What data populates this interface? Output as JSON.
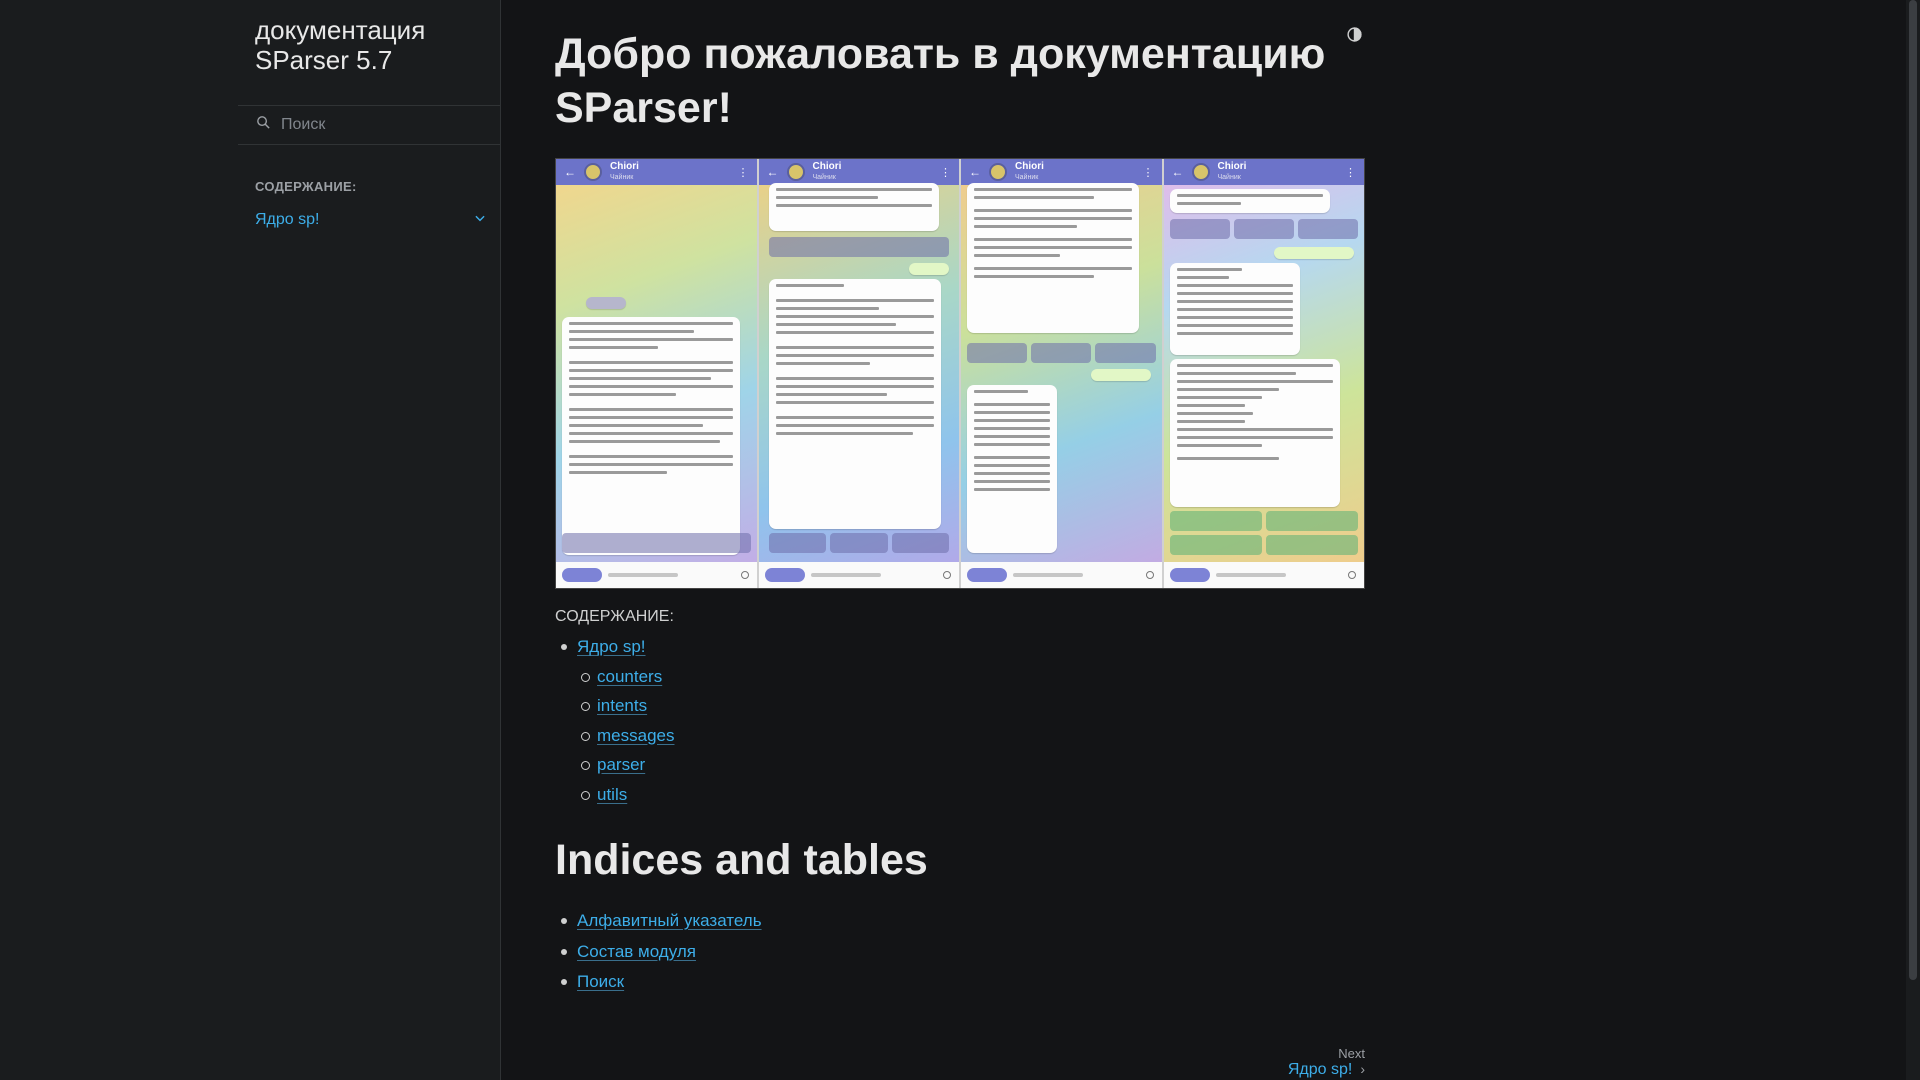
{
  "sidebar": {
    "brand": "документация SParser 5.7",
    "search_placeholder": "Поиск",
    "toc_caption": "СОДЕРЖАНИЕ:",
    "toc_item": "Ядро sp!"
  },
  "main": {
    "title": "Добро пожаловать в документацию SParser!",
    "toc_caption": "СОДЕРЖАНИЕ:",
    "toc": {
      "root": "Ядро sp!",
      "children": [
        "counters",
        "intents",
        "messages",
        "parser",
        "utils"
      ]
    },
    "indices_title": "Indices and tables",
    "indices": [
      "Алфавитный указатель",
      "Состав модуля",
      "Поиск"
    ],
    "next_label": "Next",
    "next_title": "Ядро sp!"
  },
  "hero": {
    "chat_name": "Chiori",
    "chat_status": "Чайник",
    "icons": [
      "back-arrow",
      "avatar",
      "kebab-menu",
      "attach",
      "menu-button"
    ]
  },
  "colors": {
    "background": "#131416",
    "sidebar": "#1a1c1e",
    "link": "#3daee9",
    "text": "#cfd0d0"
  }
}
